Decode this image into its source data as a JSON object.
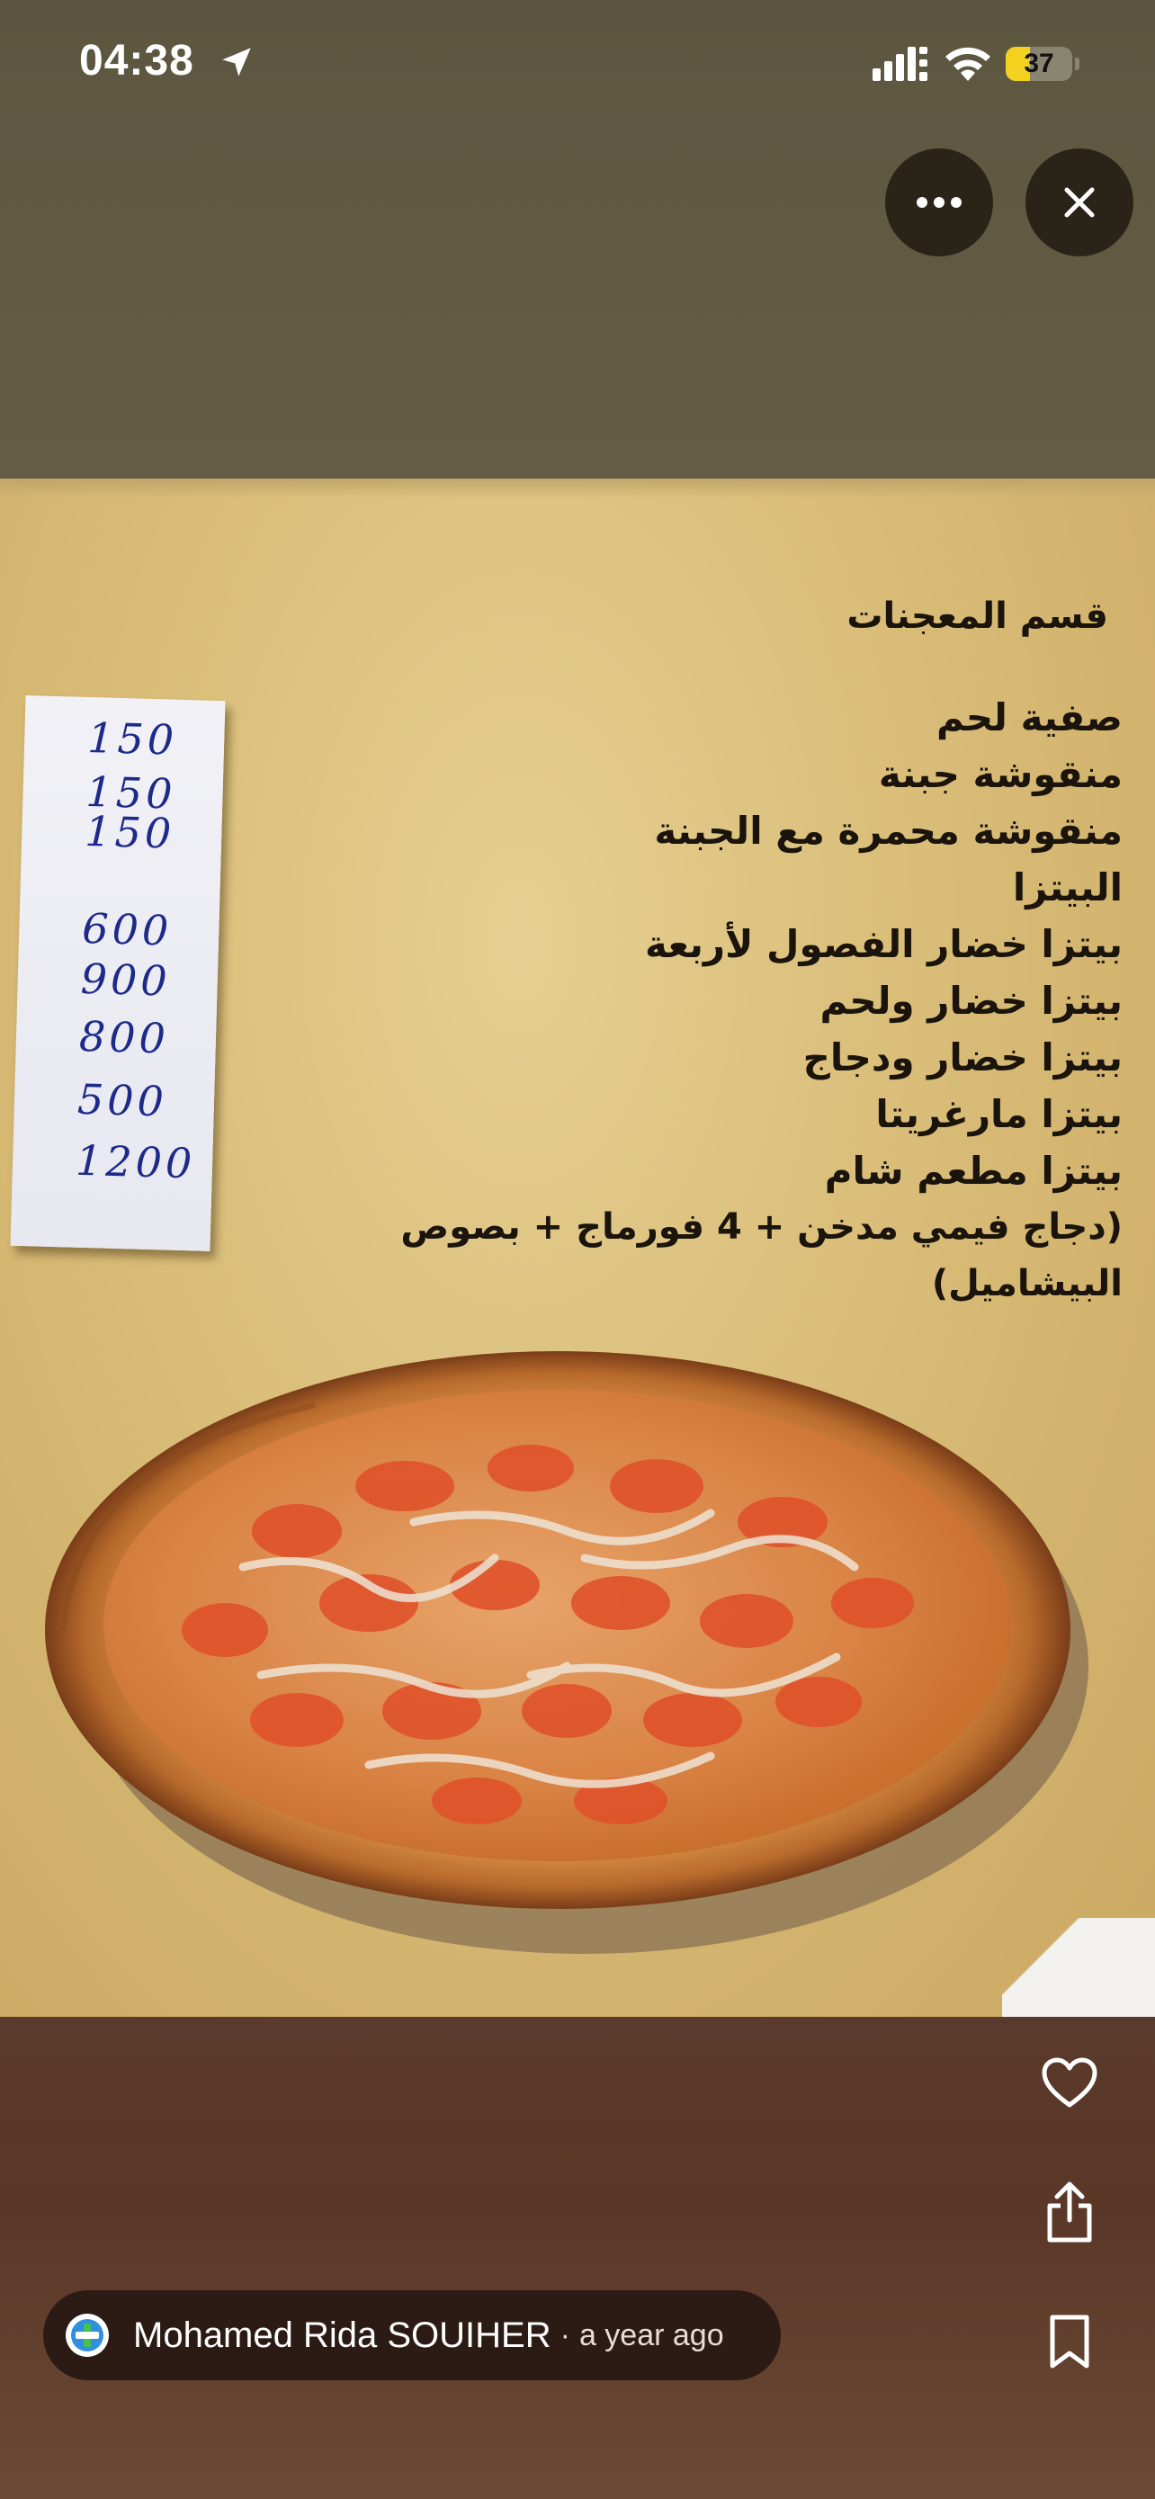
{
  "status_bar": {
    "time": "04:38",
    "battery_level": "37",
    "battery_fraction": 0.37
  },
  "top_controls": {
    "more_icon": "ellipsis-icon",
    "close_icon": "close-icon"
  },
  "photo": {
    "prices": [
      "150",
      "150",
      "150",
      "600",
      "900",
      "800",
      "500",
      "1200"
    ],
    "menu_title": "قسم المعجنات",
    "menu_items": [
      "صفية لحم",
      "منقوشة جبنة",
      "منقوشة محمرة مع الجبنة",
      "البيتزا",
      "بيتزا خضار الفصول لأربعة",
      "بيتزا خضار ولحم",
      "بيتزا خضار ودجاج",
      "بيتزا مارغريتا",
      "بيتزا مطعم شام"
    ],
    "menu_note": "(دجاج فيمي مدخن + 4 فورماج + بصوص البيشاميل)"
  },
  "actions": {
    "like_icon": "heart-icon",
    "share_icon": "share-icon",
    "save_icon": "bookmark-icon"
  },
  "author": {
    "name": "Mohamed Rida SOUIHER",
    "separator": "·",
    "time_ago": "a year ago",
    "badge_color": "#2f8fe0",
    "badge_accent": "#48c04a"
  }
}
